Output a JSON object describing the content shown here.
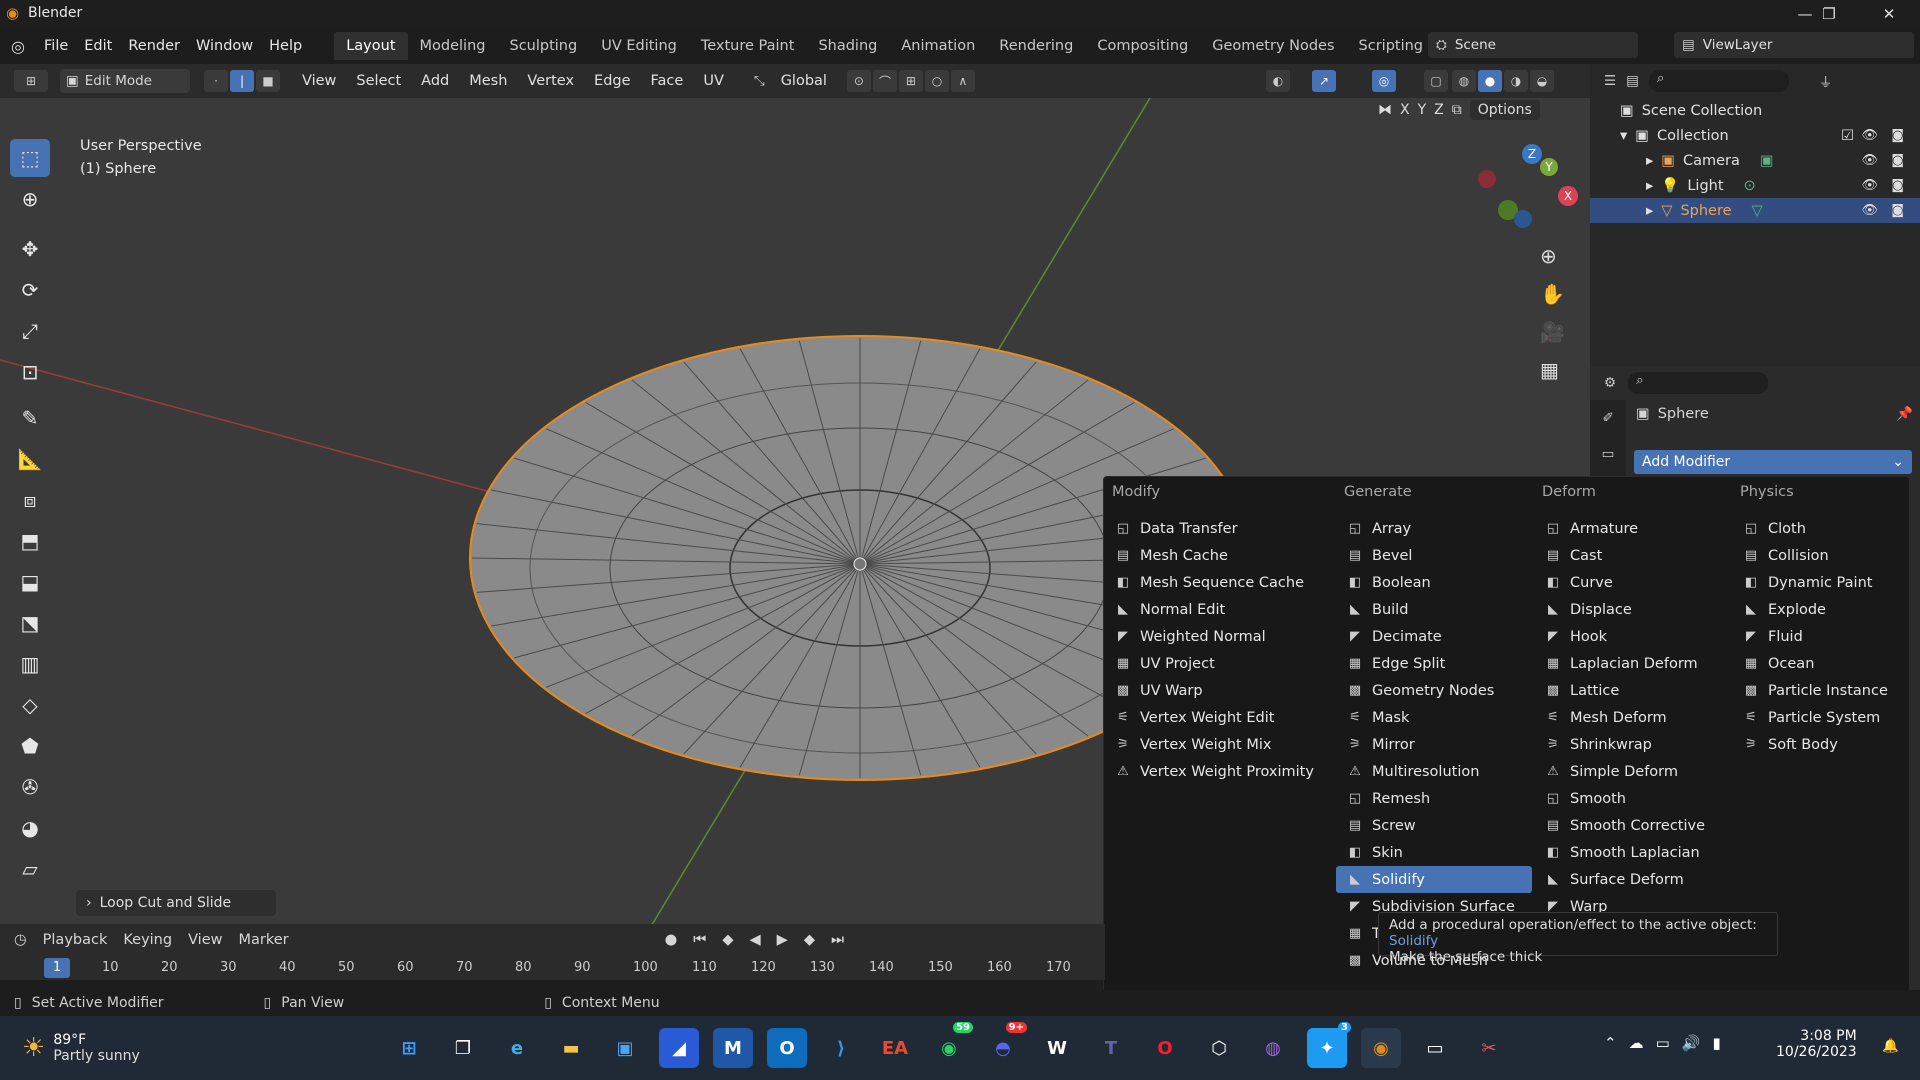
{
  "window": {
    "title": "Blender",
    "min": "—",
    "max": "❐",
    "close": "✕"
  },
  "menu": [
    "File",
    "Edit",
    "Render",
    "Window",
    "Help"
  ],
  "workspaces": [
    "Layout",
    "Modeling",
    "Sculpting",
    "UV Editing",
    "Texture Paint",
    "Shading",
    "Animation",
    "Rendering",
    "Compositing",
    "Geometry Nodes",
    "Scripting",
    "+"
  ],
  "scene": {
    "name": "Scene",
    "viewlayer": "ViewLayer"
  },
  "viewport_header": {
    "mode": "Edit Mode",
    "items": [
      "View",
      "Select",
      "Add",
      "Mesh",
      "Vertex",
      "Edge",
      "Face",
      "UV"
    ],
    "orientation": "Global",
    "axes": [
      "X",
      "Y",
      "Z"
    ],
    "options": "Options"
  },
  "viewport": {
    "perspective": "User Perspective",
    "object": "(1) Sphere",
    "last_op": "Loop Cut and Slide"
  },
  "outliner": {
    "scene_collection": "Scene Collection",
    "collection": "Collection",
    "items": [
      {
        "name": "Camera"
      },
      {
        "name": "Light"
      },
      {
        "name": "Sphere"
      }
    ]
  },
  "properties": {
    "object": "Sphere",
    "add_modifier": "Add Modifier"
  },
  "modifier_menu": {
    "columns": [
      {
        "title": "Modify",
        "items": [
          "Data Transfer",
          "Mesh Cache",
          "Mesh Sequence Cache",
          "Normal Edit",
          "Weighted Normal",
          "UV Project",
          "UV Warp",
          "Vertex Weight Edit",
          "Vertex Weight Mix",
          "Vertex Weight Proximity"
        ]
      },
      {
        "title": "Generate",
        "items": [
          "Array",
          "Bevel",
          "Boolean",
          "Build",
          "Decimate",
          "Edge Split",
          "Geometry Nodes",
          "Mask",
          "Mirror",
          "Multiresolution",
          "Remesh",
          "Screw",
          "Skin",
          "Solidify",
          "Subdivision Surface",
          "Triangulate",
          "Volume to Mesh"
        ]
      },
      {
        "title": "Deform",
        "items": [
          "Armature",
          "Cast",
          "Curve",
          "Displace",
          "Hook",
          "Laplacian Deform",
          "Lattice",
          "Mesh Deform",
          "Shrinkwrap",
          "Simple Deform",
          "Smooth",
          "Smooth Corrective",
          "Smooth Laplacian",
          "Surface Deform",
          "Warp"
        ]
      },
      {
        "title": "Physics",
        "items": [
          "Cloth",
          "Collision",
          "Dynamic Paint",
          "Explode",
          "Fluid",
          "Ocean",
          "Particle Instance",
          "Particle System",
          "Soft Body"
        ]
      }
    ],
    "highlighted": "Solidify",
    "tooltip_line1": "Add a procedural operation/effect to the active object:",
    "tooltip_name": "Solidify",
    "tooltip_line2": "Make the surface thick"
  },
  "timeline": {
    "menus": [
      "Playback",
      "Keying",
      "View",
      "Marker"
    ],
    "current_frame": "1",
    "ticks": [
      "10",
      "20",
      "30",
      "40",
      "50",
      "60",
      "70",
      "80",
      "90",
      "100",
      "110",
      "120",
      "130",
      "140",
      "150",
      "160",
      "170"
    ]
  },
  "statusbar": {
    "left": "Set Active Modifier",
    "mid": "Pan View",
    "right": "Context Menu"
  },
  "taskbar": {
    "weather_temp": "89°F",
    "weather_desc": "Partly sunny",
    "time": "3:08 PM",
    "date": "10/26/2023",
    "badges": {
      "whatsapp": "59",
      "discord": "9+",
      "twitter": "3"
    }
  },
  "colors": {
    "accent": "#4772b3",
    "outline": "#e88a1b",
    "viewport_bg": "#3a3a3a"
  }
}
